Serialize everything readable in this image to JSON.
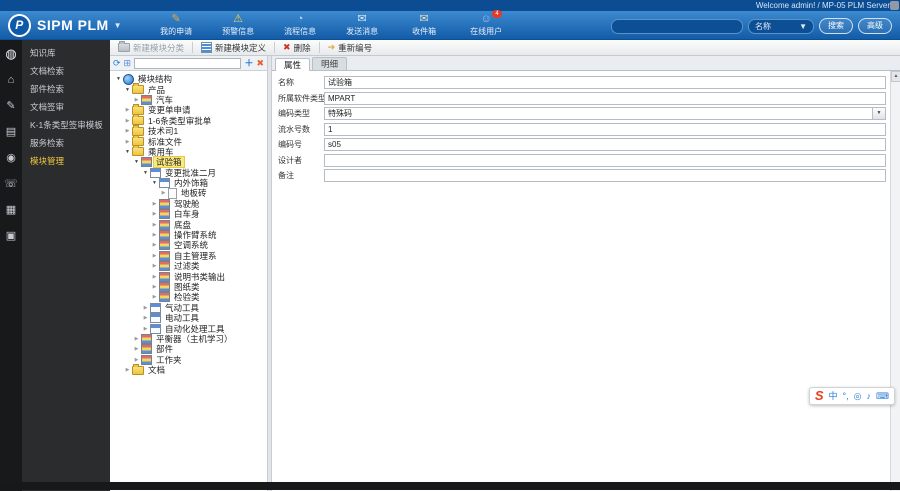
{
  "window": {
    "welcome": "Welcome admin! / MP-05 PLM Server"
  },
  "header": {
    "logo": "SIPM PLM",
    "tools": [
      {
        "name": "my-requests",
        "label": "我的申请",
        "glyph": "✎",
        "color": "#f0a43c"
      },
      {
        "name": "alert-info",
        "label": "预警信息",
        "glyph": "⚠",
        "color": "#f5d442"
      },
      {
        "name": "process-info",
        "label": "流程信息",
        "glyph": "◔",
        "color": "#bcd6ef"
      },
      {
        "name": "send-message",
        "label": "发送消息",
        "glyph": "✉",
        "color": "#dce9f6"
      },
      {
        "name": "inbox",
        "label": "收件箱",
        "glyph": "✉",
        "color": "#e8d9c0"
      },
      {
        "name": "online-users",
        "label": "在线用户",
        "glyph": "☺",
        "color": "#9cc4ea",
        "badge": "4"
      }
    ],
    "search": {
      "dropdown_value": "名称",
      "search_button": "搜索",
      "advanced_button": "高级"
    }
  },
  "sidebar": {
    "rail": [
      {
        "name": "app-icon",
        "glyph": "◍"
      },
      {
        "name": "home-icon",
        "glyph": "⌂"
      },
      {
        "name": "edit-icon",
        "glyph": "✎"
      },
      {
        "name": "layers-icon",
        "glyph": "▤"
      },
      {
        "name": "disc-icon",
        "glyph": "◉"
      },
      {
        "name": "phone-icon",
        "glyph": "☏"
      },
      {
        "name": "book-icon",
        "glyph": "▦"
      },
      {
        "name": "monitor-icon",
        "glyph": "▣"
      }
    ],
    "items": [
      {
        "label": "知识库",
        "active": false
      },
      {
        "label": "文档检索",
        "active": false
      },
      {
        "label": "部件检索",
        "active": false
      },
      {
        "label": "文档签审",
        "active": false
      },
      {
        "label": "K-1条类型签审模板",
        "active": false
      },
      {
        "label": "服务检索",
        "active": false
      },
      {
        "label": "模块管理",
        "active": true
      }
    ]
  },
  "toolbar": {
    "buttons": [
      {
        "name": "new-module-category",
        "label": "新建模块分类",
        "icon": "folder",
        "disabled": true
      },
      {
        "name": "new-module-definition",
        "label": "新建模块定义",
        "icon": "list",
        "disabled": false
      },
      {
        "name": "delete",
        "label": "删除",
        "icon": "delete",
        "disabled": false
      },
      {
        "name": "renumber",
        "label": "重新编号",
        "icon": "renumber",
        "disabled": false
      }
    ]
  },
  "tree": {
    "nodes": [
      {
        "level": 0,
        "arrow": "down",
        "icon": "root",
        "label": "模块结构",
        "selected": false
      },
      {
        "level": 1,
        "arrow": "down",
        "icon": "folder",
        "label": "产品",
        "selected": false
      },
      {
        "level": 2,
        "arrow": "right",
        "icon": "module",
        "label": "汽车",
        "selected": false
      },
      {
        "level": 1,
        "arrow": "right",
        "icon": "folder",
        "label": "变更单申请",
        "selected": false
      },
      {
        "level": 1,
        "arrow": "right",
        "icon": "folder",
        "label": "1-6条类型审批单",
        "selected": false
      },
      {
        "level": 1,
        "arrow": "right",
        "icon": "folder",
        "label": "技术司1",
        "selected": false
      },
      {
        "level": 1,
        "arrow": "right",
        "icon": "folder",
        "label": "标准文件",
        "selected": false
      },
      {
        "level": 1,
        "arrow": "down",
        "icon": "folder",
        "label": "乘用车",
        "selected": false
      },
      {
        "level": 2,
        "arrow": "down",
        "icon": "module",
        "label": "试验箱",
        "selected": true
      },
      {
        "level": 3,
        "arrow": "down",
        "icon": "winmod",
        "label": "变更批准二月",
        "selected": false
      },
      {
        "level": 4,
        "arrow": "down",
        "icon": "winmod",
        "label": "内外饰箱",
        "selected": false
      },
      {
        "level": 5,
        "arrow": "right",
        "icon": "doc",
        "label": "地板砖",
        "selected": false
      },
      {
        "level": 4,
        "arrow": "right",
        "icon": "module",
        "label": "驾驶舱",
        "selected": false
      },
      {
        "level": 4,
        "arrow": "right",
        "icon": "module",
        "label": "白车身",
        "selected": false
      },
      {
        "level": 4,
        "arrow": "right",
        "icon": "module",
        "label": "底盘",
        "selected": false
      },
      {
        "level": 4,
        "arrow": "right",
        "icon": "module",
        "label": "操作臂系统",
        "selected": false
      },
      {
        "level": 4,
        "arrow": "right",
        "icon": "module",
        "label": "空调系统",
        "selected": false
      },
      {
        "level": 4,
        "arrow": "right",
        "icon": "module",
        "label": "自主管理系",
        "selected": false
      },
      {
        "level": 4,
        "arrow": "right",
        "icon": "module",
        "label": "过滤类",
        "selected": false
      },
      {
        "level": 4,
        "arrow": "right",
        "icon": "module",
        "label": "说明书类输出",
        "selected": false
      },
      {
        "level": 4,
        "arrow": "right",
        "icon": "module",
        "label": "图纸类",
        "selected": false
      },
      {
        "level": 4,
        "arrow": "right",
        "icon": "module",
        "label": "检验类",
        "selected": false
      },
      {
        "level": 3,
        "arrow": "right",
        "icon": "winmod",
        "label": "气动工具",
        "selected": false
      },
      {
        "level": 3,
        "arrow": "right",
        "icon": "winmod",
        "label": "电动工具",
        "selected": false
      },
      {
        "level": 3,
        "arrow": "right",
        "icon": "winmod",
        "label": "自动化处理工具",
        "selected": false
      },
      {
        "level": 2,
        "arrow": "right",
        "icon": "module",
        "label": "平衡器（主机学习）",
        "selected": false
      },
      {
        "level": 2,
        "arrow": "right",
        "icon": "module",
        "label": "部件",
        "selected": false
      },
      {
        "level": 2,
        "arrow": "right",
        "icon": "module",
        "label": "工作夹",
        "selected": false
      },
      {
        "level": 1,
        "arrow": "right",
        "icon": "folder",
        "label": "文档",
        "selected": false
      }
    ]
  },
  "detail": {
    "tabs": [
      {
        "label": "属性",
        "active": true
      },
      {
        "label": "明细",
        "active": false
      }
    ],
    "fields": [
      {
        "label": "名称",
        "value": "试验箱",
        "type": "text"
      },
      {
        "label": "所属软件类型",
        "value": "MPART",
        "type": "text"
      },
      {
        "label": "编码类型",
        "value": "特殊码",
        "type": "select"
      },
      {
        "label": "流水号数",
        "value": "1",
        "type": "text"
      },
      {
        "label": "编码号",
        "value": "s05",
        "type": "text"
      },
      {
        "label": "设计者",
        "value": "",
        "type": "text"
      },
      {
        "label": "备注",
        "value": "",
        "type": "text"
      }
    ]
  },
  "ime": {
    "logo": "S",
    "icons": [
      {
        "name": "chinese-mode-icon",
        "glyph": "中"
      },
      {
        "name": "punctuation-icon",
        "glyph": "°,"
      },
      {
        "name": "emoji-icon",
        "glyph": "◎"
      },
      {
        "name": "mic-icon",
        "glyph": "♪"
      },
      {
        "name": "keyboard-icon",
        "glyph": "⌨"
      }
    ]
  }
}
